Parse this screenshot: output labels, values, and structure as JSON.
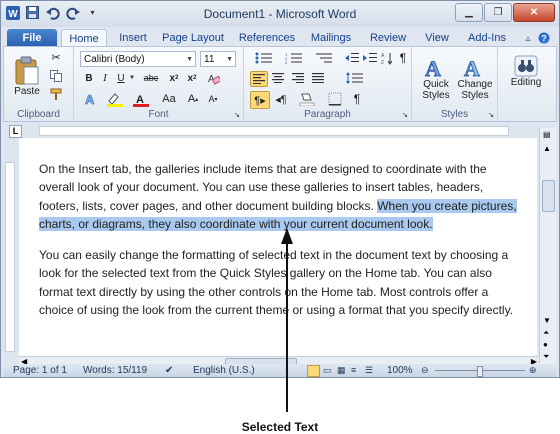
{
  "window": {
    "title": "Document1  -  Microsoft Word"
  },
  "tabs": [
    "File",
    "Home",
    "Insert",
    "Page Layout",
    "References",
    "Mailings",
    "Review",
    "View",
    "Add-Ins"
  ],
  "ribbon": {
    "clipboard": {
      "paste": "Paste",
      "label": "Clipboard"
    },
    "font": {
      "name": "Calibri (Body)",
      "size": "11",
      "label": "Font",
      "bold": "B",
      "italic": "I",
      "underline": "U",
      "strike": "abc",
      "sub": "x",
      "sup": "x",
      "grow": "A",
      "shrink": "A",
      "case": "Aa",
      "color_glyph": "A"
    },
    "paragraph": {
      "label": "Paragraph"
    },
    "styles": {
      "quick": "Quick\nStyles",
      "change": "Change\nStyles",
      "label": "Styles",
      "quick1": "Quick",
      "quick2": "Styles",
      "change1": "Change",
      "change2": "Styles"
    },
    "editing": {
      "label": "Editing"
    }
  },
  "document": {
    "p1_before": "On the Insert tab, the galleries include items that are designed to coordinate with the overall look of your document. You can use these galleries to insert tables, headers, footers, lists, cover pages, and other document building blocks. ",
    "p1_selected": "When you create pictures, charts, or diagrams, they also coordinate with your current document look.",
    "p2": "You can easily change the formatting of selected text in the document text by choosing a look for the selected text from the Quick Styles gallery on the Home tab. You can also format text directly by using the other controls on the Home tab. Most controls offer a choice of using the look from the current theme or using a format that you specify directly."
  },
  "statusbar": {
    "page": "Page: 1 of 1",
    "words": "Words: 15/119",
    "language": "English (U.S.)",
    "zoom": "100%"
  },
  "caption": "Selected Text",
  "colors": {
    "selection": "#a9c9ee",
    "accent": "#2a5fb1"
  }
}
